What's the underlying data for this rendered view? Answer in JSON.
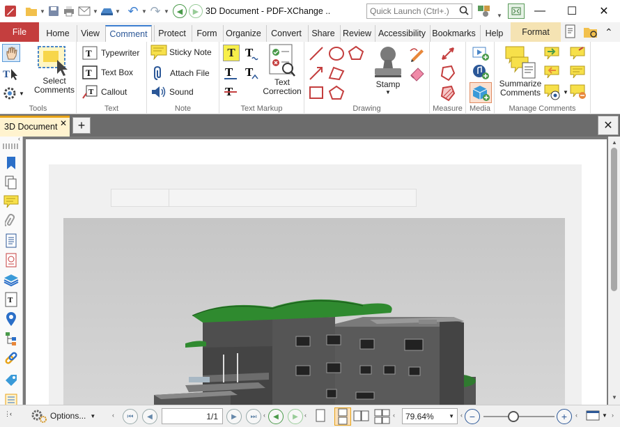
{
  "window": {
    "title": "3D Document - PDF-XChange ..",
    "quick_launch_placeholder": "Quick Launch (Ctrl+.)"
  },
  "tabs": {
    "file": "File",
    "items": [
      "Home",
      "View",
      "Comment",
      "Protect",
      "Form",
      "Organize",
      "Convert",
      "Share",
      "Review",
      "Accessibility",
      "Bookmarks",
      "Help"
    ],
    "active": "Comment",
    "contextual": "Format"
  },
  "ribbon": {
    "tools": {
      "group": "Tools",
      "select_line1": "Select",
      "select_line2": "Comments"
    },
    "text": {
      "group": "Text",
      "typewriter": "Typewriter",
      "text_box": "Text Box",
      "callout": "Callout"
    },
    "note": {
      "group": "Note",
      "sticky_note": "Sticky Note",
      "attach_file": "Attach File",
      "sound": "Sound"
    },
    "text_markup": {
      "group": "Text Markup",
      "text_correction_line1": "Text",
      "text_correction_line2": "Correction"
    },
    "drawing": {
      "group": "Drawing",
      "stamp": "Stamp"
    },
    "measure": {
      "group": "Measure"
    },
    "media": {
      "group": "Media"
    },
    "manage": {
      "group": "Manage Comments",
      "summarize_line1": "Summarize",
      "summarize_line2": "Comments"
    }
  },
  "document_tab": {
    "name": "3D Document"
  },
  "status": {
    "options": "Options...",
    "page": "1/1",
    "zoom": "79.64%"
  },
  "colors": {
    "file_tab": "#c43e3e",
    "format_tab": "#f5e3b3",
    "doc_tab": "#fff3cf",
    "accent": "#3c7fd1"
  }
}
